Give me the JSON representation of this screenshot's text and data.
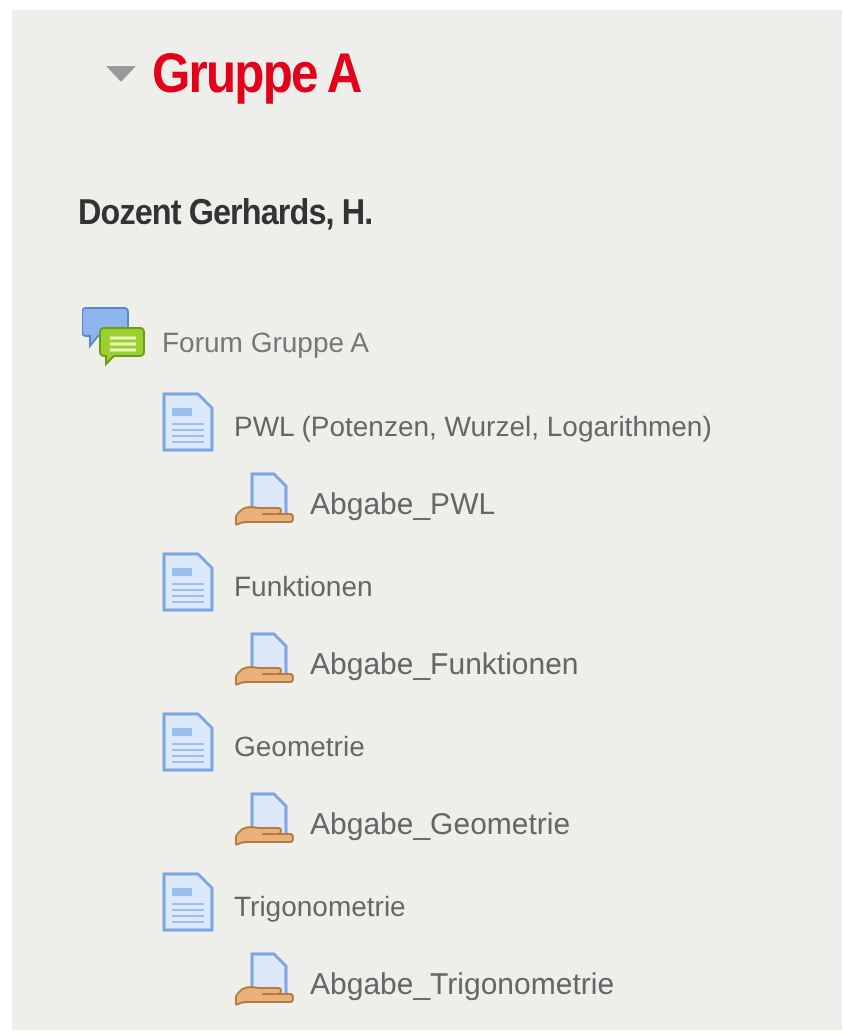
{
  "section": {
    "title": "Gruppe A",
    "expanded": true
  },
  "teacher": "Dozent Gerhards, H.",
  "activities": [
    {
      "kind": "forum",
      "label": "Forum Gruppe A",
      "children": [
        {
          "kind": "page",
          "label": "PWL (Potenzen, Wurzel, Logarithmen)",
          "children": [
            {
              "kind": "assignment",
              "label": "Abgabe_PWL"
            }
          ]
        },
        {
          "kind": "page",
          "label": "Funktionen",
          "children": [
            {
              "kind": "assignment",
              "label": "Abgabe_Funktionen"
            }
          ]
        },
        {
          "kind": "page",
          "label": "Geometrie",
          "children": [
            {
              "kind": "assignment",
              "label": "Abgabe_Geometrie"
            }
          ]
        },
        {
          "kind": "page",
          "label": "Trigonometrie",
          "children": [
            {
              "kind": "assignment",
              "label": "Abgabe_Trigonometrie"
            }
          ]
        }
      ]
    }
  ]
}
